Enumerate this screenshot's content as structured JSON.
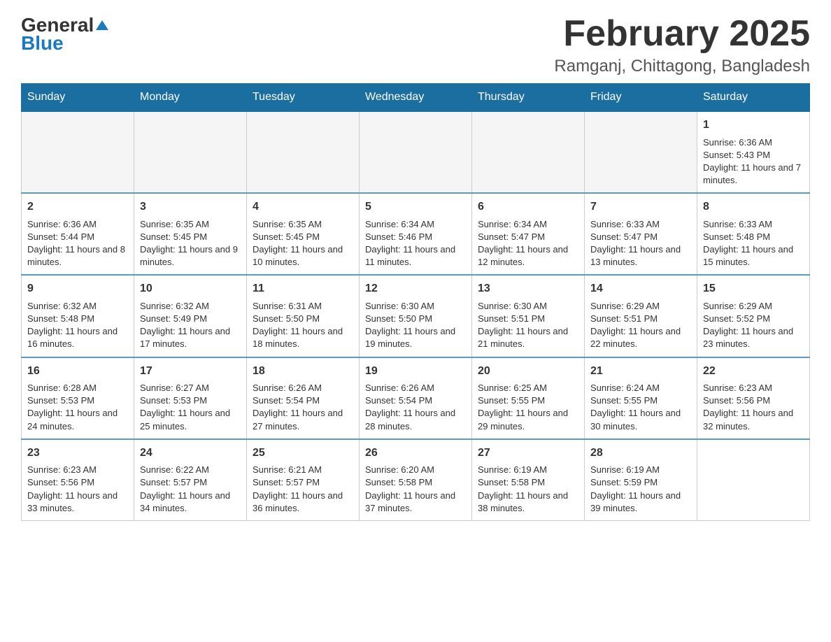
{
  "header": {
    "logo": {
      "general": "General",
      "blue": "Blue"
    },
    "title": "February 2025",
    "location": "Ramganj, Chittagong, Bangladesh"
  },
  "weekdays": [
    "Sunday",
    "Monday",
    "Tuesday",
    "Wednesday",
    "Thursday",
    "Friday",
    "Saturday"
  ],
  "weeks": [
    [
      {
        "day": "",
        "info": ""
      },
      {
        "day": "",
        "info": ""
      },
      {
        "day": "",
        "info": ""
      },
      {
        "day": "",
        "info": ""
      },
      {
        "day": "",
        "info": ""
      },
      {
        "day": "",
        "info": ""
      },
      {
        "day": "1",
        "info": "Sunrise: 6:36 AM\nSunset: 5:43 PM\nDaylight: 11 hours and 7 minutes."
      }
    ],
    [
      {
        "day": "2",
        "info": "Sunrise: 6:36 AM\nSunset: 5:44 PM\nDaylight: 11 hours and 8 minutes."
      },
      {
        "day": "3",
        "info": "Sunrise: 6:35 AM\nSunset: 5:45 PM\nDaylight: 11 hours and 9 minutes."
      },
      {
        "day": "4",
        "info": "Sunrise: 6:35 AM\nSunset: 5:45 PM\nDaylight: 11 hours and 10 minutes."
      },
      {
        "day": "5",
        "info": "Sunrise: 6:34 AM\nSunset: 5:46 PM\nDaylight: 11 hours and 11 minutes."
      },
      {
        "day": "6",
        "info": "Sunrise: 6:34 AM\nSunset: 5:47 PM\nDaylight: 11 hours and 12 minutes."
      },
      {
        "day": "7",
        "info": "Sunrise: 6:33 AM\nSunset: 5:47 PM\nDaylight: 11 hours and 13 minutes."
      },
      {
        "day": "8",
        "info": "Sunrise: 6:33 AM\nSunset: 5:48 PM\nDaylight: 11 hours and 15 minutes."
      }
    ],
    [
      {
        "day": "9",
        "info": "Sunrise: 6:32 AM\nSunset: 5:48 PM\nDaylight: 11 hours and 16 minutes."
      },
      {
        "day": "10",
        "info": "Sunrise: 6:32 AM\nSunset: 5:49 PM\nDaylight: 11 hours and 17 minutes."
      },
      {
        "day": "11",
        "info": "Sunrise: 6:31 AM\nSunset: 5:50 PM\nDaylight: 11 hours and 18 minutes."
      },
      {
        "day": "12",
        "info": "Sunrise: 6:30 AM\nSunset: 5:50 PM\nDaylight: 11 hours and 19 minutes."
      },
      {
        "day": "13",
        "info": "Sunrise: 6:30 AM\nSunset: 5:51 PM\nDaylight: 11 hours and 21 minutes."
      },
      {
        "day": "14",
        "info": "Sunrise: 6:29 AM\nSunset: 5:51 PM\nDaylight: 11 hours and 22 minutes."
      },
      {
        "day": "15",
        "info": "Sunrise: 6:29 AM\nSunset: 5:52 PM\nDaylight: 11 hours and 23 minutes."
      }
    ],
    [
      {
        "day": "16",
        "info": "Sunrise: 6:28 AM\nSunset: 5:53 PM\nDaylight: 11 hours and 24 minutes."
      },
      {
        "day": "17",
        "info": "Sunrise: 6:27 AM\nSunset: 5:53 PM\nDaylight: 11 hours and 25 minutes."
      },
      {
        "day": "18",
        "info": "Sunrise: 6:26 AM\nSunset: 5:54 PM\nDaylight: 11 hours and 27 minutes."
      },
      {
        "day": "19",
        "info": "Sunrise: 6:26 AM\nSunset: 5:54 PM\nDaylight: 11 hours and 28 minutes."
      },
      {
        "day": "20",
        "info": "Sunrise: 6:25 AM\nSunset: 5:55 PM\nDaylight: 11 hours and 29 minutes."
      },
      {
        "day": "21",
        "info": "Sunrise: 6:24 AM\nSunset: 5:55 PM\nDaylight: 11 hours and 30 minutes."
      },
      {
        "day": "22",
        "info": "Sunrise: 6:23 AM\nSunset: 5:56 PM\nDaylight: 11 hours and 32 minutes."
      }
    ],
    [
      {
        "day": "23",
        "info": "Sunrise: 6:23 AM\nSunset: 5:56 PM\nDaylight: 11 hours and 33 minutes."
      },
      {
        "day": "24",
        "info": "Sunrise: 6:22 AM\nSunset: 5:57 PM\nDaylight: 11 hours and 34 minutes."
      },
      {
        "day": "25",
        "info": "Sunrise: 6:21 AM\nSunset: 5:57 PM\nDaylight: 11 hours and 36 minutes."
      },
      {
        "day": "26",
        "info": "Sunrise: 6:20 AM\nSunset: 5:58 PM\nDaylight: 11 hours and 37 minutes."
      },
      {
        "day": "27",
        "info": "Sunrise: 6:19 AM\nSunset: 5:58 PM\nDaylight: 11 hours and 38 minutes."
      },
      {
        "day": "28",
        "info": "Sunrise: 6:19 AM\nSunset: 5:59 PM\nDaylight: 11 hours and 39 minutes."
      },
      {
        "day": "",
        "info": ""
      }
    ]
  ]
}
